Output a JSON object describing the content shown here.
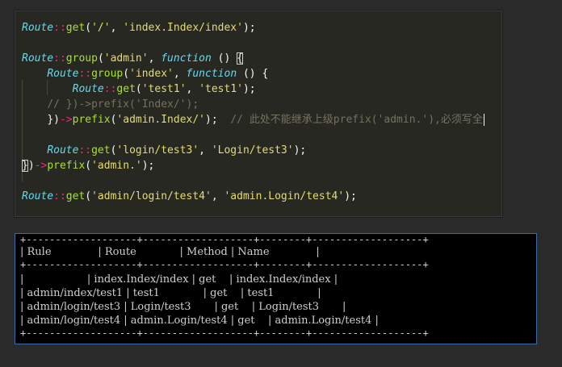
{
  "code": {
    "line1": {
      "class": "Route",
      "op": "::",
      "method": "get",
      "open": "(",
      "arg1": "'/'",
      "sep": ", ",
      "arg2": "'index.Index/index'",
      "close": ");"
    },
    "line3": {
      "class": "Route",
      "op": "::",
      "method": "group",
      "open": "(",
      "arg1": "'admin'",
      "sep": ", ",
      "keyword": "function",
      "rest": " () ",
      "brace": "{"
    },
    "line4": {
      "class": "Route",
      "op": "::",
      "method": "group",
      "open": "(",
      "arg1": "'index'",
      "sep": ", ",
      "keyword": "function",
      "rest": " () {"
    },
    "line5": {
      "class": "Route",
      "op": "::",
      "method": "get",
      "open": "(",
      "arg1": "'test1'",
      "sep": ", ",
      "arg2": "'test1'",
      "close": ");"
    },
    "line6": {
      "comment": "// })->prefix('Index/');"
    },
    "line7": {
      "close_group": "})",
      "arrow": "->",
      "method": "prefix",
      "open": "(",
      "arg": "'admin.Index/'",
      "close": ");",
      "comment": "// 此处不能继承上级prefix('admin.'),必须写全"
    },
    "line9": {
      "class": "Route",
      "op": "::",
      "method": "get",
      "open": "(",
      "arg1": "'login/test3'",
      "sep": ", ",
      "arg2": "'Login/test3'",
      "close": ");"
    },
    "line10": {
      "close_brace": "}",
      "close_paren": ")",
      "arrow": "->",
      "method": "prefix",
      "open": "(",
      "arg": "'admin.'",
      "close": ");"
    },
    "line12": {
      "class": "Route",
      "op": "::",
      "method": "get",
      "open": "(",
      "arg1": "'admin/login/test4'",
      "sep": ", ",
      "arg2": "'admin.Login/test4'",
      "close": ");"
    }
  },
  "console": {
    "border": "+-------------------+-------------------+--------+-------------------+",
    "header": "| Rule              | Route             | Method | Name              |",
    "rows": [
      "|                   | index.Index/index | get    | index.Index/index |",
      "| admin/index/test1 | test1             | get    | test1             |",
      "| admin/login/test3 | Login/test3       | get    | Login/test3       |",
      "| admin/login/test4 | admin.Login/test4 | get    | admin.Login/test4 |"
    ]
  },
  "colors": {
    "editor_bg": "#272822",
    "class_color": "#66d9ef",
    "operator_color": "#f92672",
    "function_color": "#a6e22e",
    "string_color": "#e6db74",
    "comment_color": "#75715e",
    "console_bg": "#000000",
    "console_border": "#3b6ea8"
  }
}
